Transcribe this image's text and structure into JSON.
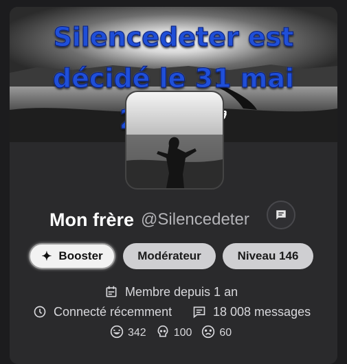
{
  "banner": {
    "line1": "Silencedeter est",
    "line2": "décidé le 31 mai",
    "line3": "2026",
    "dove": "🕊"
  },
  "profile": {
    "display_name": "Mon frère",
    "handle": "@Silencedeter"
  },
  "badges": {
    "booster": "Booster",
    "moderator": "Modérateur",
    "level": "Niveau 146"
  },
  "meta": {
    "member_since": "Membre depuis 1 an",
    "last_seen": "Connecté récemment",
    "messages": "18 008 messages"
  },
  "reactions": [
    {
      "icon": "laughing-face-icon",
      "count": "342"
    },
    {
      "icon": "skull-face-icon",
      "count": "100"
    },
    {
      "icon": "crying-face-icon",
      "count": "60"
    }
  ],
  "colors": {
    "banner_text": "#1f4fd8",
    "card_bg": "#2a2a2c",
    "chip_grey": "#cfcfd2"
  }
}
